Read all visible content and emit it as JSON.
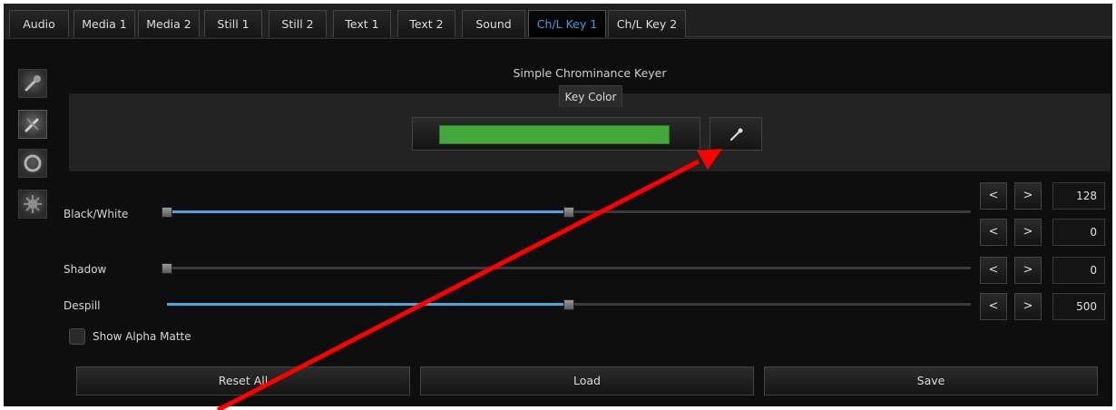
{
  "tabs": [
    {
      "label": "Audio"
    },
    {
      "label": "Media 1"
    },
    {
      "label": "Media 2"
    },
    {
      "label": "Still 1"
    },
    {
      "label": "Still 2"
    },
    {
      "label": "Text 1"
    },
    {
      "label": "Text 2"
    },
    {
      "label": "Sound"
    },
    {
      "label": "Ch/L Key 1",
      "active": true
    },
    {
      "label": "Ch/L Key 2"
    }
  ],
  "toolbar": {
    "tools": [
      {
        "icon": "magic-wand-icon"
      },
      {
        "icon": "chroma-key-icon",
        "active": true
      },
      {
        "icon": "circle-mask-icon"
      },
      {
        "icon": "gear-burst-icon"
      }
    ]
  },
  "keyer": {
    "title": "Simple Chrominance Keyer",
    "key_color_label": "Key Color",
    "key_color": "#43a83b",
    "eyedropper_icon": "eyedropper-icon"
  },
  "sliders": {
    "black_white": {
      "label": "Black/White",
      "low_value": "128",
      "high_value": "0",
      "low_fraction": 0.0,
      "high_fraction": 0.5
    },
    "shadow": {
      "label": "Shadow",
      "value": "0",
      "fraction": 0.0
    },
    "despill": {
      "label": "Despill",
      "value": "500",
      "fraction": 0.5
    }
  },
  "stepper": {
    "decrement_label": "<",
    "increment_label": ">"
  },
  "options": {
    "show_alpha_matte_label": "Show Alpha Matte",
    "show_alpha_matte_checked": false
  },
  "buttons": {
    "reset_all": "Reset All",
    "load": "Load",
    "save": "Save"
  },
  "colors": {
    "accent": "#4aa6dc",
    "active_tab_text": "#3e9de0",
    "annotation_arrow": "#ff0000"
  },
  "annotation": {
    "type": "red-arrow",
    "points_to": "eyedropper-button"
  }
}
